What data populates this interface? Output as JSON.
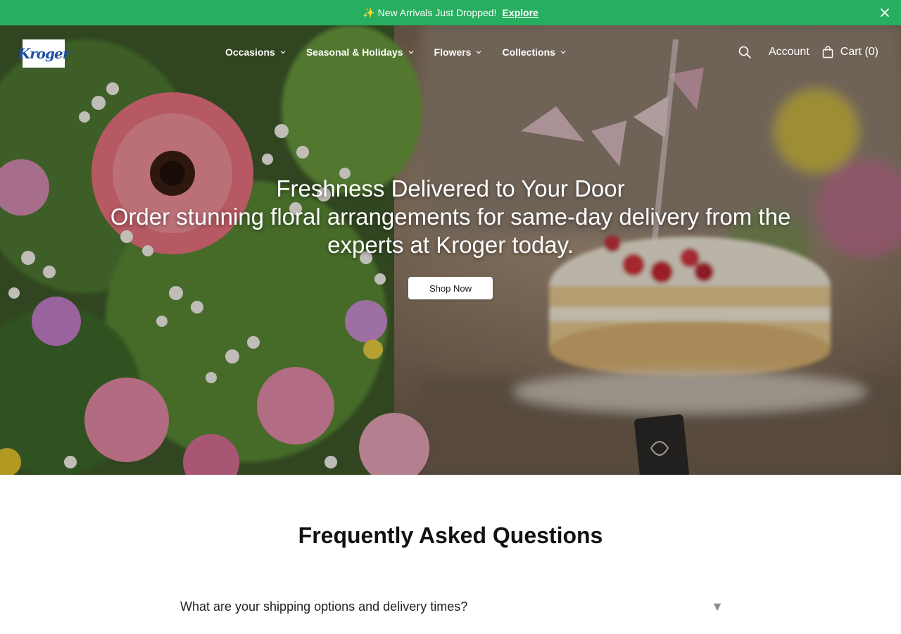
{
  "announcement": {
    "sparkle": "✨",
    "text": "New Arrivals Just Dropped!",
    "link": "Explore"
  },
  "header": {
    "logo_text": "Kroger",
    "nav": [
      {
        "label": "Occasions"
      },
      {
        "label": "Seasonal & Holidays"
      },
      {
        "label": "Flowers"
      },
      {
        "label": "Collections"
      }
    ],
    "account_label": "Account",
    "cart_label": "Cart (0)"
  },
  "hero": {
    "title": "Freshness Delivered to Your Door",
    "subtitle": "Order stunning floral arrangements for same-day delivery from the experts at Kroger today.",
    "cta": "Shop Now"
  },
  "faq": {
    "title": "Frequently Asked Questions",
    "questions": [
      {
        "q": "What are your shipping options and delivery times?",
        "arrow": "▼"
      }
    ]
  },
  "colors": {
    "announcement_bg": "#27ae60",
    "logo_blue": "#1f4fa3"
  },
  "icons": [
    "close-icon",
    "search-icon",
    "cart-bag-icon",
    "chevron-down-icon"
  ]
}
